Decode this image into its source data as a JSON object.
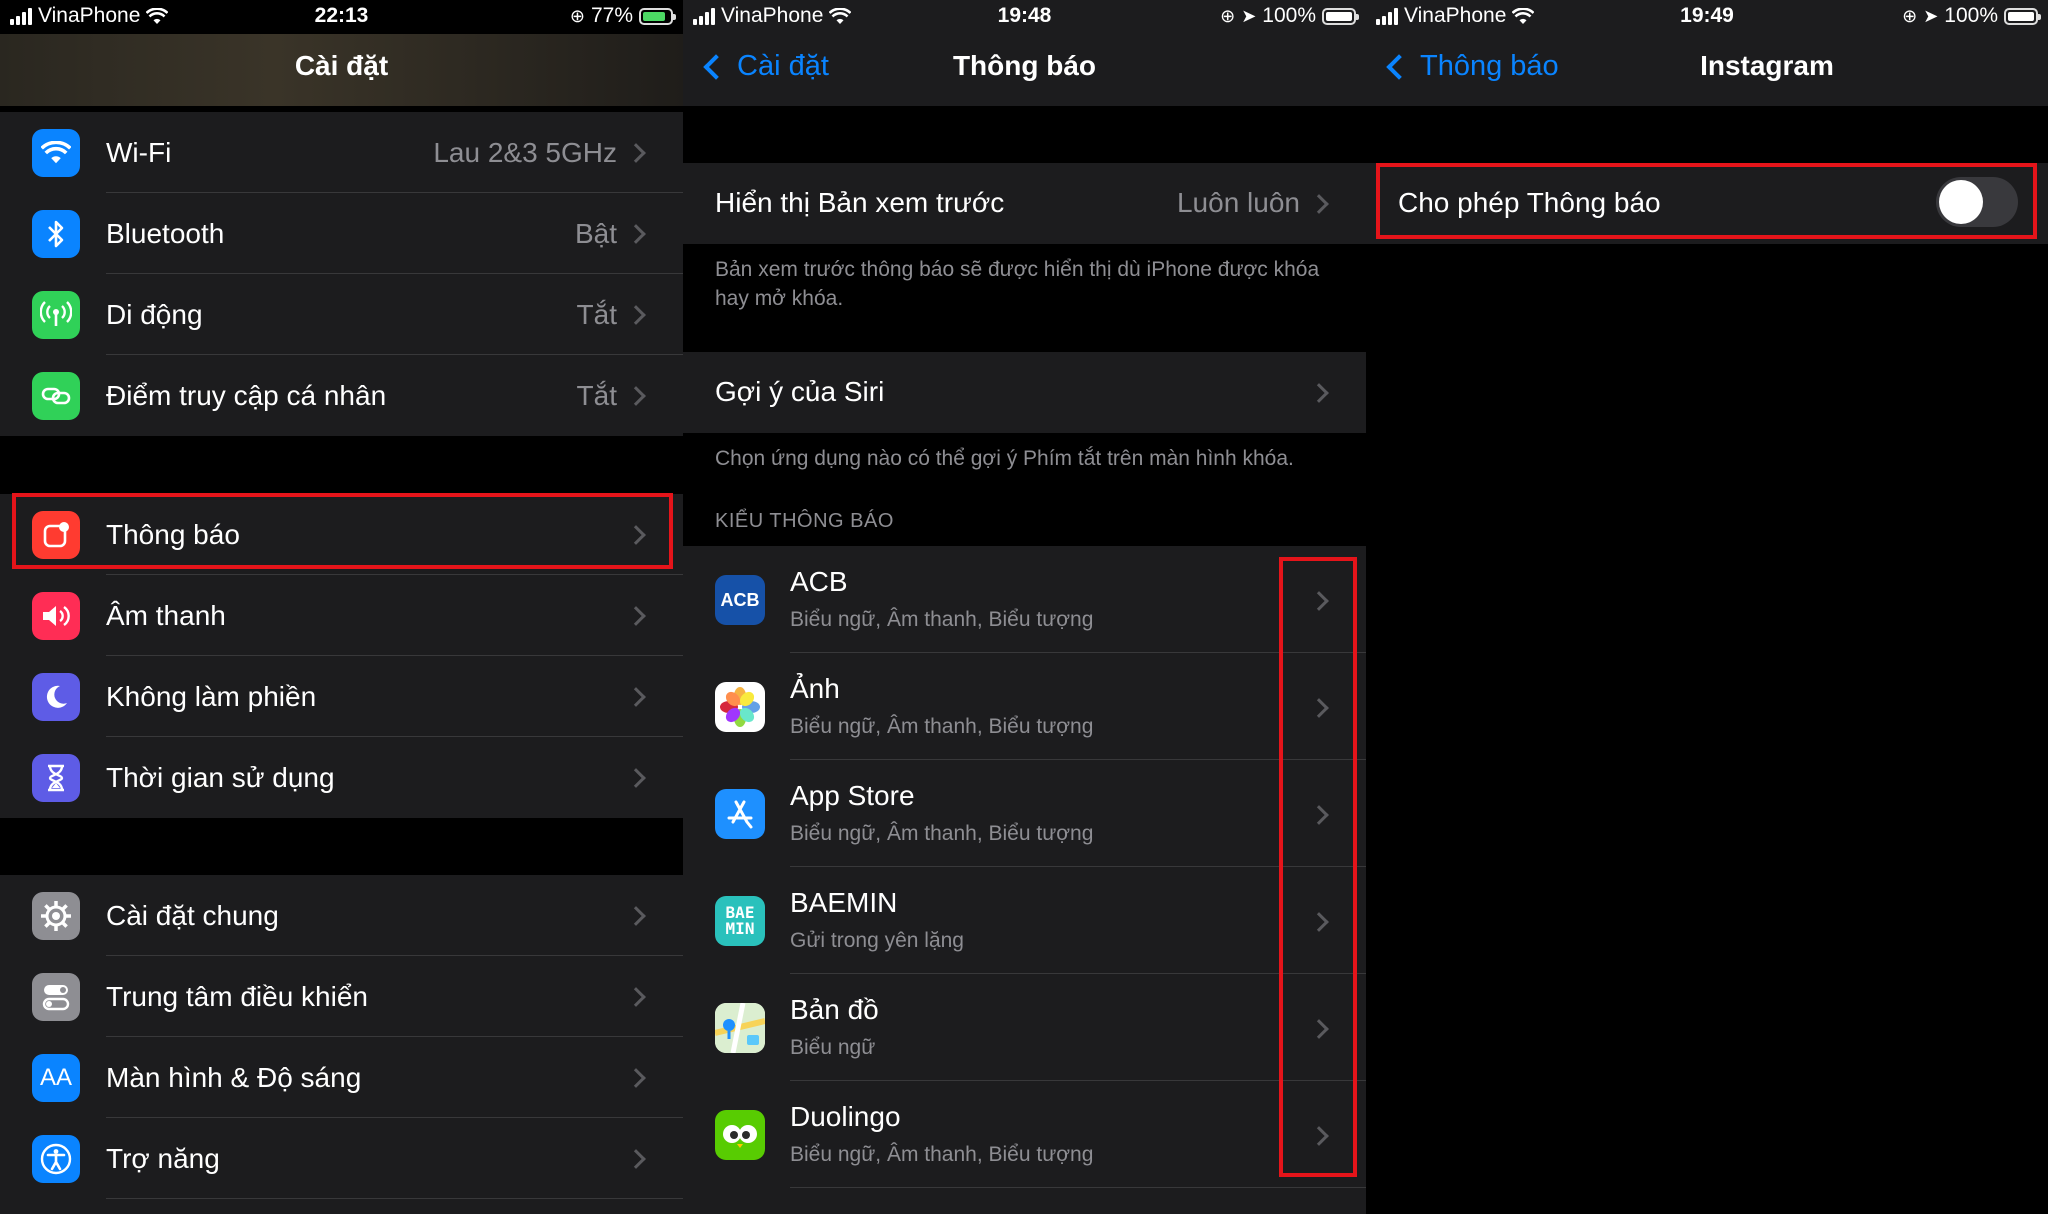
{
  "screen1": {
    "status": {
      "carrier": "VinaPhone",
      "time": "22:13",
      "battery": "77%"
    },
    "title": "Cài đặt",
    "group1": [
      {
        "label": "Wi-Fi",
        "value": "Lau 2&3 5GHz",
        "icon": "wifi-icon",
        "color": "#0a84ff"
      },
      {
        "label": "Bluetooth",
        "value": "Bật",
        "icon": "bluetooth-icon",
        "color": "#0a84ff"
      },
      {
        "label": "Di động",
        "value": "Tắt",
        "icon": "cellular-icon",
        "color": "#30d158"
      },
      {
        "label": "Điểm truy cập cá nhân",
        "value": "Tắt",
        "icon": "hotspot-icon",
        "color": "#30d158"
      }
    ],
    "group2": [
      {
        "label": "Thông báo",
        "icon": "notifications-icon",
        "color": "#ff3b30"
      },
      {
        "label": "Âm thanh",
        "icon": "sound-icon",
        "color": "#ff2d55"
      },
      {
        "label": "Không làm phiền",
        "icon": "moon-icon",
        "color": "#5e5ce6"
      },
      {
        "label": "Thời gian sử dụng",
        "icon": "hourglass-icon",
        "color": "#5e5ce6"
      }
    ],
    "group3": [
      {
        "label": "Cài đặt chung",
        "icon": "gear-icon",
        "color": "#8e8e93"
      },
      {
        "label": "Trung tâm điều khiển",
        "icon": "control-center-icon",
        "color": "#8e8e93"
      },
      {
        "label": "Màn hình & Độ sáng",
        "icon": "display-icon",
        "color": "#0a84ff",
        "glyph": "AA"
      },
      {
        "label": "Trợ năng",
        "icon": "accessibility-icon",
        "color": "#0a84ff"
      }
    ]
  },
  "screen2": {
    "status": {
      "carrier": "VinaPhone",
      "time": "19:48",
      "battery": "100%"
    },
    "back": "Cài đặt",
    "title": "Thông báo",
    "preview": {
      "label": "Hiển thị Bản xem trước",
      "value": "Luôn luôn"
    },
    "preview_note": "Bản xem trước thông báo sẽ được hiển thị dù iPhone được khóa hay mở khóa.",
    "siri": {
      "label": "Gợi ý của Siri"
    },
    "siri_note": "Chọn ứng dụng nào có thể gợi ý Phím tắt trên màn hình khóa.",
    "section": "KIỂU THÔNG BÁO",
    "apps": [
      {
        "name": "ACB",
        "sub": "Biểu ngữ, Âm thanh, Biểu tượng",
        "icon": "acb-icon",
        "glyph": "ACB"
      },
      {
        "name": "Ảnh",
        "sub": "Biểu ngữ, Âm thanh, Biểu tượng",
        "icon": "photos-icon"
      },
      {
        "name": "App Store",
        "sub": "Biểu ngữ, Âm thanh, Biểu tượng",
        "icon": "app-store-icon"
      },
      {
        "name": "BAEMIN",
        "sub": "Gửi trong yên lặng",
        "icon": "baemin-icon",
        "glyph1": "BAE",
        "glyph2": "MIN"
      },
      {
        "name": "Bản đồ",
        "sub": "Biểu ngữ",
        "icon": "maps-icon"
      },
      {
        "name": "Duolingo",
        "sub": "Biểu ngữ, Âm thanh, Biểu tượng",
        "icon": "duolingo-icon"
      }
    ]
  },
  "screen3": {
    "status": {
      "carrier": "VinaPhone",
      "time": "19:49",
      "battery": "100%"
    },
    "back": "Thông báo",
    "title": "Instagram",
    "allow": {
      "label": "Cho phép Thông báo",
      "on": false
    }
  }
}
